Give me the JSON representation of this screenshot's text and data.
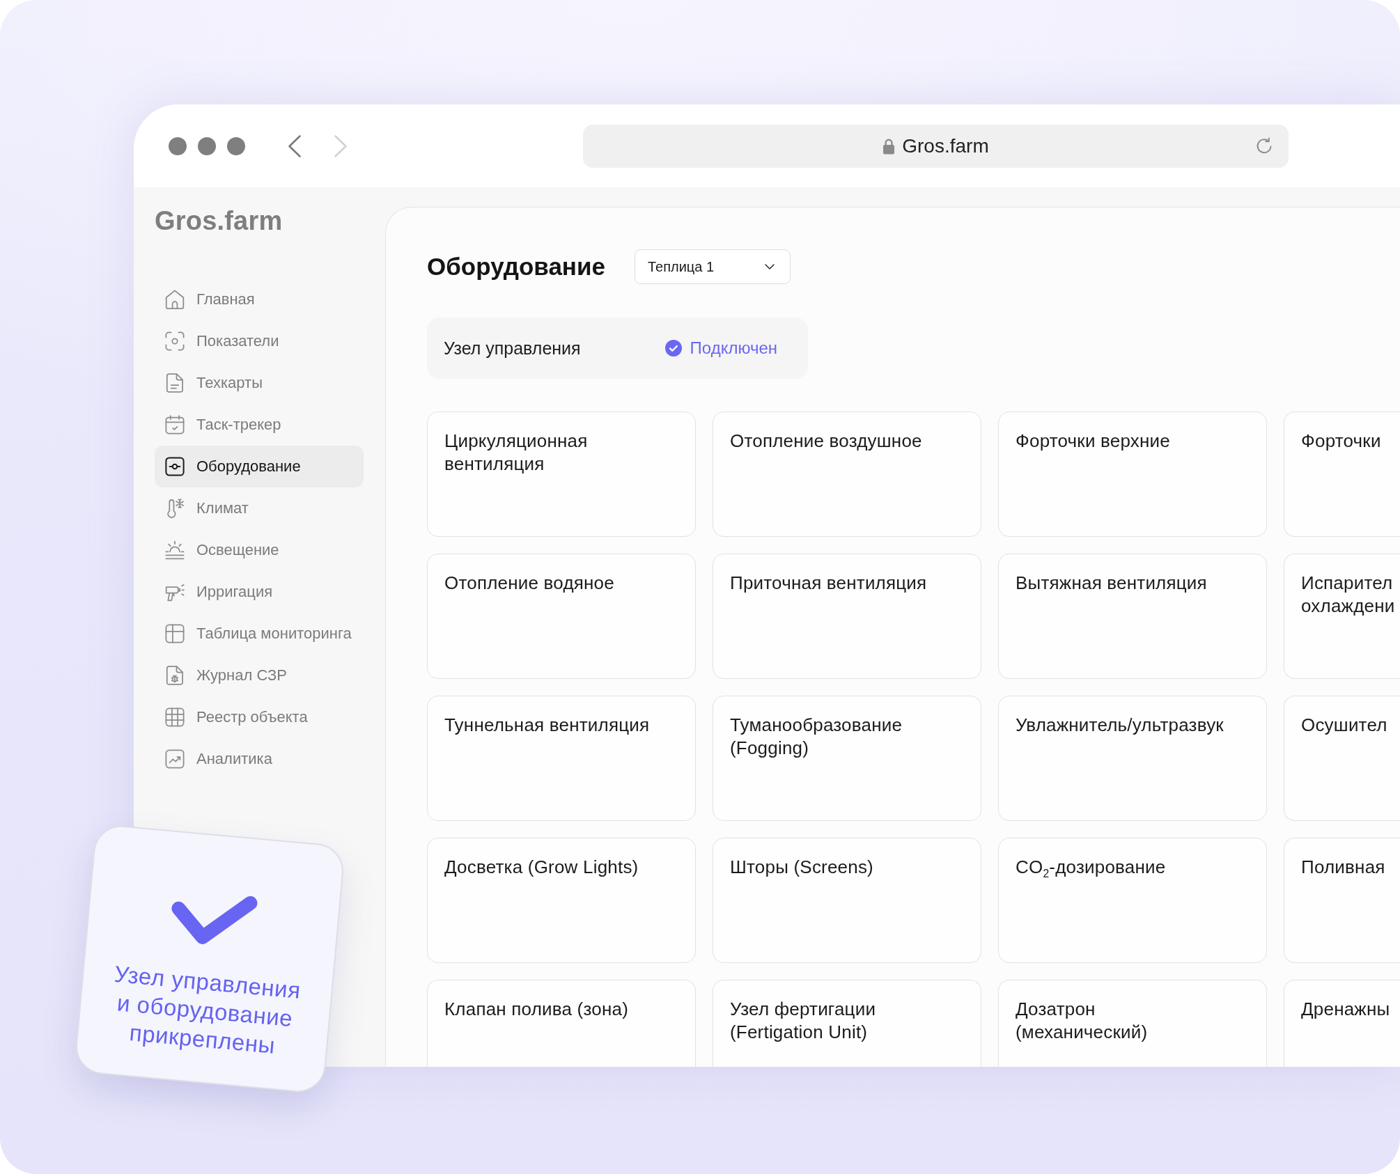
{
  "browser": {
    "address": "Gros.farm",
    "back": {
      "disabled": false
    },
    "forward": {
      "disabled": true
    }
  },
  "sidebar": {
    "logo": "Gros.farm",
    "items": [
      {
        "label": "Главная",
        "selected": false
      },
      {
        "label": "Показатели",
        "selected": false
      },
      {
        "label": "Техкарты",
        "selected": false
      },
      {
        "label": "Таск-трекер",
        "selected": false
      },
      {
        "label": "Оборудование",
        "selected": true
      },
      {
        "label": "Климат",
        "selected": false
      },
      {
        "label": "Освещение",
        "selected": false
      },
      {
        "label": "Ирригация",
        "selected": false
      },
      {
        "label": "Таблица мониторинга",
        "selected": false
      },
      {
        "label": "Журнал СЗР",
        "selected": false
      },
      {
        "label": "Реестр объекта",
        "selected": false
      },
      {
        "label": "Аналитика",
        "selected": false
      }
    ]
  },
  "page": {
    "title": "Оборудование",
    "greenhouse_select": {
      "value": "Теплица 1"
    },
    "control_node": {
      "label": "Узел управления",
      "status": "Подключен",
      "connected": true
    },
    "equipment": [
      {
        "title": "Циркуляционная\nвентиляция"
      },
      {
        "title": "Отопление воздушное"
      },
      {
        "title": "Форточки верхние"
      },
      {
        "title": "Форточки"
      },
      {
        "title": "Отопление водяное"
      },
      {
        "title": "Приточная вентиляция"
      },
      {
        "title": "Вытяжная вентиляция"
      },
      {
        "title": "Испарител\nохлаждени"
      },
      {
        "title": "Туннельная вентиляция"
      },
      {
        "title": "Туманообразование\n(Fogging)"
      },
      {
        "title": "Увлажнитель/ультразвук"
      },
      {
        "title": "Осушител"
      },
      {
        "title": "Досветка (Grow Lights)"
      },
      {
        "title": "Шторы (Screens)"
      },
      {
        "title": "CO$_{2}$-дозирование"
      },
      {
        "title": "Поливная"
      },
      {
        "title": "Клапан полива (зона)"
      },
      {
        "title": "Узел фертигации\n(Fertigation Unit)"
      },
      {
        "title": "Дозатрон\n(механический)"
      },
      {
        "title": "Дренажны"
      }
    ]
  },
  "overlay_card": {
    "caption": "Узел управления\nи оборудование\nприкреплены"
  }
}
